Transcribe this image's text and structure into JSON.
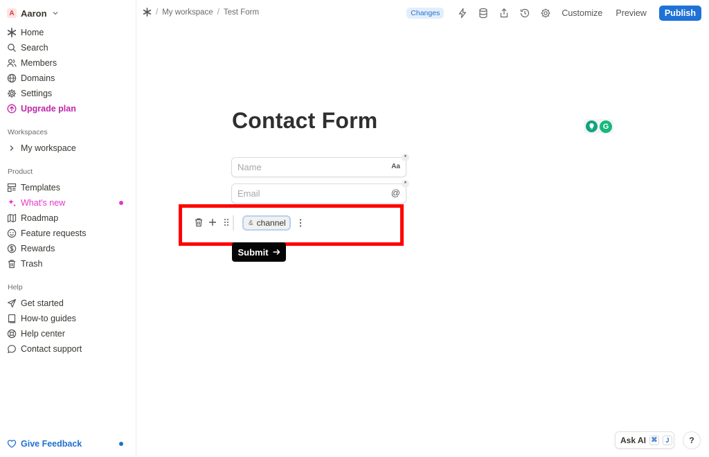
{
  "sidebar": {
    "user": {
      "initial": "A",
      "name": "Aaron"
    },
    "nav": [
      {
        "label": "Home",
        "icon": "asterisk-icon"
      },
      {
        "label": "Search",
        "icon": "search-icon"
      },
      {
        "label": "Members",
        "icon": "members-icon"
      },
      {
        "label": "Domains",
        "icon": "globe-icon"
      },
      {
        "label": "Settings",
        "icon": "gear-icon"
      },
      {
        "label": "Upgrade plan",
        "icon": "upgrade-icon"
      }
    ],
    "workspaces_label": "Workspaces",
    "workspace_item": "My workspace",
    "product_label": "Product",
    "product": [
      {
        "label": "Templates",
        "icon": "templates-icon"
      },
      {
        "label": "What's new",
        "icon": "sparkles-icon"
      },
      {
        "label": "Roadmap",
        "icon": "map-icon"
      },
      {
        "label": "Feature requests",
        "icon": "smiley-icon"
      },
      {
        "label": "Rewards",
        "icon": "dollar-icon"
      },
      {
        "label": "Trash",
        "icon": "trash-icon"
      }
    ],
    "help_label": "Help",
    "help": [
      {
        "label": "Get started",
        "icon": "send-icon"
      },
      {
        "label": "How-to guides",
        "icon": "book-icon"
      },
      {
        "label": "Help center",
        "icon": "lifebuoy-icon"
      },
      {
        "label": "Contact support",
        "icon": "chat-icon"
      }
    ],
    "feedback": "Give Feedback"
  },
  "topbar": {
    "breadcrumb": [
      "My workspace",
      "Test Form"
    ],
    "changes": "Changes",
    "customize": "Customize",
    "preview": "Preview",
    "publish": "Publish"
  },
  "form": {
    "title": "Contact Form",
    "name_placeholder": "Name",
    "email_placeholder": "Email",
    "required_mark": "*",
    "name_type": "Aa",
    "email_type": "@",
    "chip_prefix": "&",
    "chip_value": "channel",
    "submit": "Submit"
  },
  "bottom": {
    "ask_ai": "Ask AI",
    "shortcut_cmd": "⌘",
    "shortcut_key": "J",
    "help": "?"
  },
  "colors": {
    "publish": "#1f72d6",
    "upgrade": "#c026a8",
    "whats_new": "#e535c9",
    "feedback": "#1f6fd1",
    "highlight": "#ff0000"
  }
}
